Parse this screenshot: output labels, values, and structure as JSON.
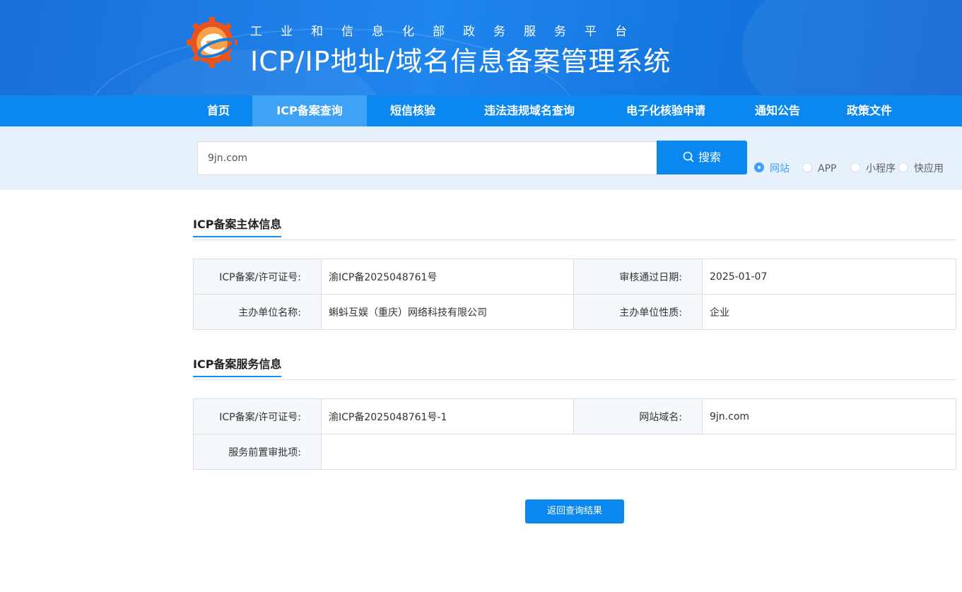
{
  "header": {
    "subtitle": "工业和信息化部政务服务平台",
    "title": "ICP/IP地址/域名信息备案管理系统"
  },
  "nav": {
    "items": [
      {
        "label": "首页"
      },
      {
        "label": "ICP备案查询",
        "active": true
      },
      {
        "label": "短信核验"
      },
      {
        "label": "违法违规域名查询"
      },
      {
        "label": "电子化核验申请"
      },
      {
        "label": "通知公告"
      },
      {
        "label": "政策文件"
      }
    ]
  },
  "search": {
    "value": "9jn.com",
    "button_label": "搜索",
    "options": [
      {
        "label": "网站",
        "checked": true
      },
      {
        "label": "APP",
        "checked": false
      },
      {
        "label": "小程序",
        "checked": false
      },
      {
        "label": "快应用",
        "checked": false
      }
    ]
  },
  "subject_info": {
    "title": "ICP备案主体信息",
    "rows": [
      {
        "label1": "ICP备案/许可证号:",
        "value1": "渝ICP备2025048761号",
        "label2": "审核通过日期:",
        "value2": "2025-01-07"
      },
      {
        "label1": "主办单位名称:",
        "value1": "蝌蚪互娱（重庆）网络科技有限公司",
        "label2": "主办单位性质:",
        "value2": "企业"
      }
    ]
  },
  "service_info": {
    "title": "ICP备案服务信息",
    "rows": [
      {
        "label1": "ICP备案/许可证号:",
        "value1": "渝ICP备2025048761号-1",
        "label2": "网站域名:",
        "value2": "9jn.com"
      }
    ],
    "approval_label": "服务前置审批项:",
    "approval_value": ""
  },
  "back_button": "返回查询结果",
  "colors": {
    "primary": "#0a88f0",
    "nav_active": "#3ea3f7",
    "radio_checked": "#409eff",
    "search_band": "#e6f1fb"
  }
}
